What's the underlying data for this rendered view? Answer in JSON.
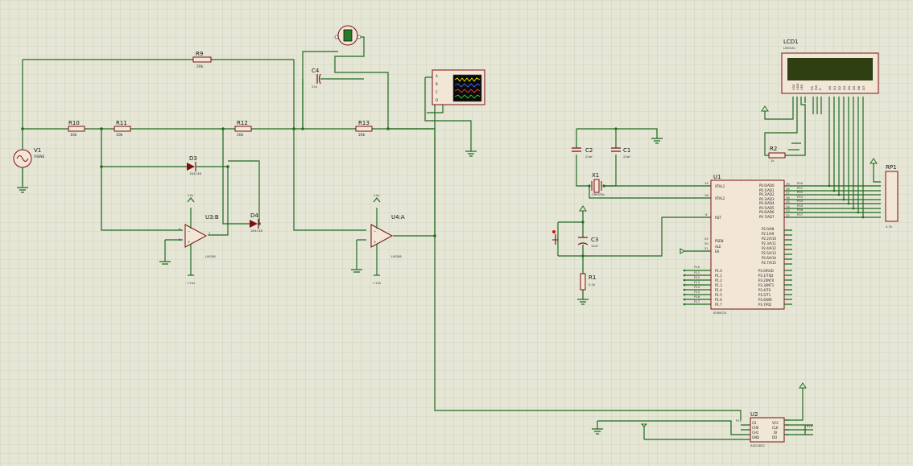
{
  "components": {
    "v1": {
      "ref": "V1",
      "value": "VSINE"
    },
    "r9": {
      "ref": "R9",
      "value": "20k"
    },
    "r10": {
      "ref": "R10",
      "value": "10k"
    },
    "r11": {
      "ref": "R11",
      "value": "10k"
    },
    "r12": {
      "ref": "R12",
      "value": "10k"
    },
    "r13": {
      "ref": "R13",
      "value": "20k"
    },
    "r1": {
      "ref": "R1",
      "value": "5.1k"
    },
    "r2": {
      "ref": "R2",
      "value": "1k"
    },
    "c1": {
      "ref": "C1",
      "value": "22pf"
    },
    "c2": {
      "ref": "C2",
      "value": "22pf"
    },
    "c3": {
      "ref": "C3",
      "value": "10uF"
    },
    "c4": {
      "ref": "C4",
      "value": "22u"
    },
    "d3": {
      "ref": "D3",
      "value": "1N4148"
    },
    "d4": {
      "ref": "D4",
      "value": "1N4148"
    },
    "u3": {
      "ref": "U3:B",
      "value": "LM358"
    },
    "u4": {
      "ref": "U4:A",
      "value": "LM358"
    },
    "x1": {
      "ref": "X1",
      "value": "CRYSTAL"
    },
    "u1": {
      "ref": "U1",
      "value": "AT89C51"
    },
    "u2": {
      "ref": "U2",
      "value": "ADC0832"
    },
    "lcd1": {
      "ref": "LCD1",
      "value": "LM016L"
    },
    "rp1": {
      "ref": "RP1",
      "value": "4.7k"
    }
  },
  "power": {
    "neg": "-15v",
    "pos": "+15v"
  },
  "u1_pins": {
    "xtal1": "XTAL1",
    "xtal2": "XTAL2",
    "rst": "RST",
    "psen": "PSEN",
    "ale": "ALE",
    "ea": "EA",
    "p0": [
      "P0.0/AD0",
      "P0.1/AD1",
      "P0.2/AD2",
      "P0.3/AD3",
      "P0.4/AD4",
      "P0.5/AD5",
      "P0.6/AD6",
      "P0.7/AD7"
    ],
    "p2": [
      "P2.0/A8",
      "P2.1/A9",
      "P2.2/A10",
      "P2.3/A11",
      "P2.4/A12",
      "P2.5/A13",
      "P2.6/A14",
      "P2.7/A15"
    ],
    "p1": [
      "P1.0",
      "P1.1",
      "P1.2",
      "P1.3",
      "P1.4",
      "P1.5",
      "P1.6",
      "P1.7"
    ],
    "p3": [
      "P3.0/RXD",
      "P3.1/TXD",
      "P3.2/INT0",
      "P3.3/INT1",
      "P3.4/T0",
      "P3.5/T1",
      "P3.6/WR",
      "P3.7/RD"
    ],
    "pin_nums_left": [
      "19",
      "18",
      "9",
      "29",
      "30",
      "31"
    ],
    "pin_nums_right": [
      "39",
      "38",
      "37",
      "36",
      "35",
      "34",
      "33",
      "32"
    ],
    "p0_net": [
      "P00",
      "P01",
      "P02",
      "P03",
      "P04",
      "P05",
      "P06",
      "P07"
    ],
    "p1_net": [
      "P10",
      "P11",
      "P12",
      "P13",
      "P14",
      "P15",
      "P16",
      "P17"
    ]
  },
  "u2_pins": {
    "left": [
      "CS",
      "CH0",
      "CH1",
      "GND"
    ],
    "right": [
      "VCC",
      "CLK",
      "DI",
      "DO"
    ],
    "net_left": "P15",
    "net_right": "P16"
  },
  "lcd_pins": [
    "VSS",
    "VDD",
    "VEE",
    "RS",
    "RW",
    "E",
    "D0",
    "D1",
    "D2",
    "D3",
    "D4",
    "D5",
    "D6",
    "D7"
  ],
  "scope_channels": [
    "A",
    "B",
    "C",
    "D"
  ],
  "colors": {
    "background": "#e6e6d6",
    "grid": "#c4c4b0",
    "wire": "#1f6a1f",
    "body": "#7a1010",
    "lcd": "#2f3f12"
  }
}
